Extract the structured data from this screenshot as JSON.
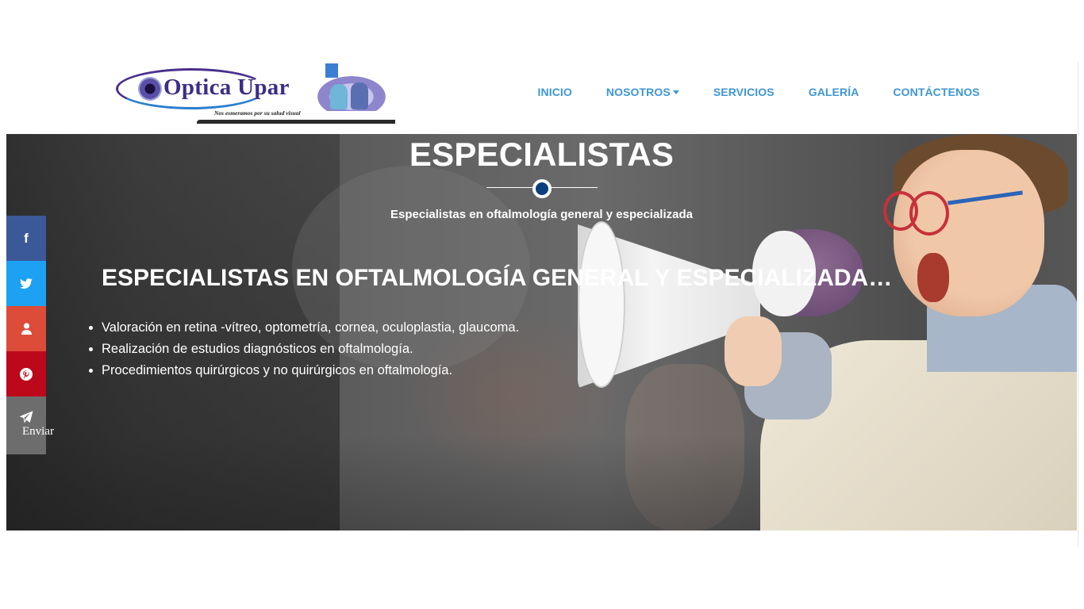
{
  "logo": {
    "brand": "Optica Upar",
    "tagline": "Nos esmeramos por su salud visual"
  },
  "nav": {
    "items": [
      {
        "label": "INICIO"
      },
      {
        "label": "NOSOTROS"
      },
      {
        "label": "SERVICIOS"
      },
      {
        "label": "GALERÍA"
      },
      {
        "label": "CONTÁCTENOS"
      }
    ]
  },
  "hero": {
    "title": "ESPECIALISTAS",
    "subtitle": "Especialistas en oftalmología general y especializada",
    "heading": "ESPECIALISTAS EN OFTALMOLOGÍA GENERAL Y ESPECIALIZADA…",
    "list": [
      "Valoración en retina -vítreo, optometría, cornea, oculoplastia, glaucoma.",
      "Realización de estudios diagnósticos en oftalmología.",
      "Procedimientos quirúrgicos y no quirúrgicos en oftalmología."
    ]
  },
  "social": {
    "buttons": [
      {
        "icon": "facebook-icon",
        "color": "#3b5998"
      },
      {
        "icon": "twitter-icon",
        "color": "#1da1f2"
      },
      {
        "icon": "user-icon",
        "color": "#dd4b39"
      },
      {
        "icon": "pinterest-icon",
        "color": "#bd081c"
      },
      {
        "icon": "paper-plane-icon",
        "color": "#6d6d6d"
      }
    ],
    "send_label": "Enviar"
  },
  "colors": {
    "nav_link": "#3f96d5",
    "divider_dot": "#0b3e7e"
  }
}
